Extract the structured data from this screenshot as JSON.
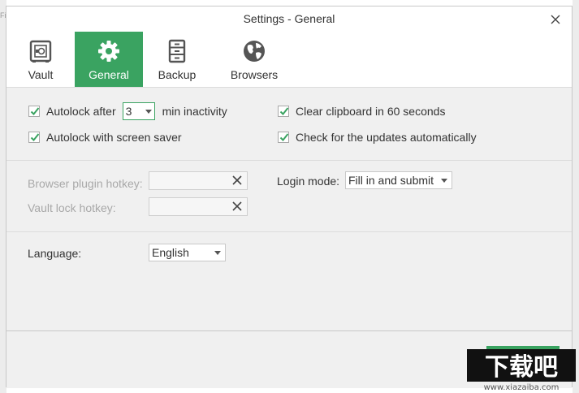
{
  "background_fragment": "Fi",
  "window": {
    "title": "Settings - General"
  },
  "tabs": [
    {
      "label": "Vault",
      "icon": "vault-icon"
    },
    {
      "label": "General",
      "icon": "gear-icon",
      "active": true
    },
    {
      "label": "Backup",
      "icon": "backup-cabinet-icon"
    },
    {
      "label": "Browsers",
      "icon": "globe-icon"
    }
  ],
  "general": {
    "autolock_label": "Autolock after",
    "autolock_value": "3",
    "autolock_suffix": "min inactivity",
    "autolock_checked": true,
    "screensaver_label": "Autolock with screen saver",
    "screensaver_checked": true,
    "clipboard_label": "Clear clipboard in 60 seconds",
    "clipboard_checked": true,
    "updates_label": "Check for the updates automatically",
    "updates_checked": true
  },
  "hotkeys": {
    "browser_plugin_label": "Browser plugin hotkey:",
    "browser_plugin_value": "",
    "vault_lock_label": "Vault lock hotkey:",
    "vault_lock_value": ""
  },
  "login": {
    "label": "Login mode:",
    "value": "Fill in and submit"
  },
  "language": {
    "label": "Language:",
    "value": "English"
  },
  "watermark": {
    "text": "下载吧",
    "url_text": "www.xiazaiba.com"
  },
  "colors": {
    "accent": "#3aa361",
    "disabled_text": "#a8a8a8",
    "title_bar": "#ffffff"
  }
}
